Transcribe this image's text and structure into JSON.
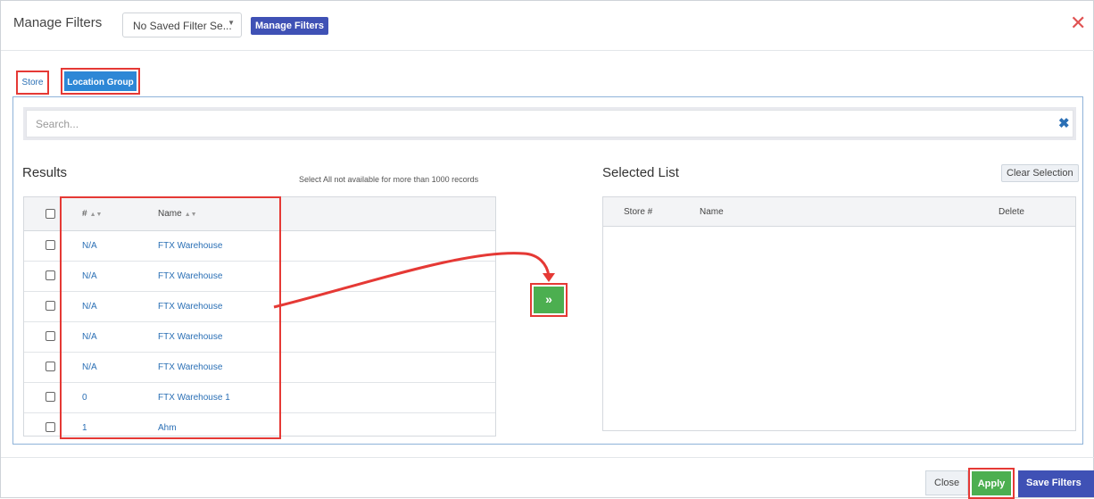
{
  "header": {
    "title": "Manage Filters",
    "saved_filter": "No Saved Filter Se...",
    "manage_button": "Manage Filters"
  },
  "tabs": [
    {
      "label": "Store",
      "active": false
    },
    {
      "label": "Location Group",
      "active": true
    }
  ],
  "search": {
    "placeholder": "Search..."
  },
  "results": {
    "title": "Results",
    "note": "Select All not available for more than 1000 records",
    "columns": [
      "#",
      "Name"
    ],
    "rows": [
      {
        "id": "N/A",
        "name": "FTX Warehouse"
      },
      {
        "id": "N/A",
        "name": "FTX Warehouse"
      },
      {
        "id": "N/A",
        "name": "FTX Warehouse"
      },
      {
        "id": "N/A",
        "name": "FTX Warehouse"
      },
      {
        "id": "N/A",
        "name": "FTX Warehouse"
      },
      {
        "id": "0",
        "name": "FTX Warehouse 1"
      },
      {
        "id": "1",
        "name": "Ahm"
      }
    ]
  },
  "move_button": "»",
  "selected": {
    "title": "Selected List",
    "clear_label": "Clear Selection",
    "columns": [
      "Store #",
      "Name",
      "Delete"
    ]
  },
  "footer": {
    "close_label": "Close",
    "apply_label": "Apply",
    "save_label": "Save Filters"
  },
  "colors": {
    "primary": "#3f51b5",
    "accent_blue": "#2d87d6",
    "success": "#4caf50",
    "annotation_red": "#e53935"
  },
  "icons": [
    "close-icon",
    "dropdown-caret-icon",
    "clear-search-icon",
    "sort-icon",
    "double-chevron-right-icon"
  ]
}
